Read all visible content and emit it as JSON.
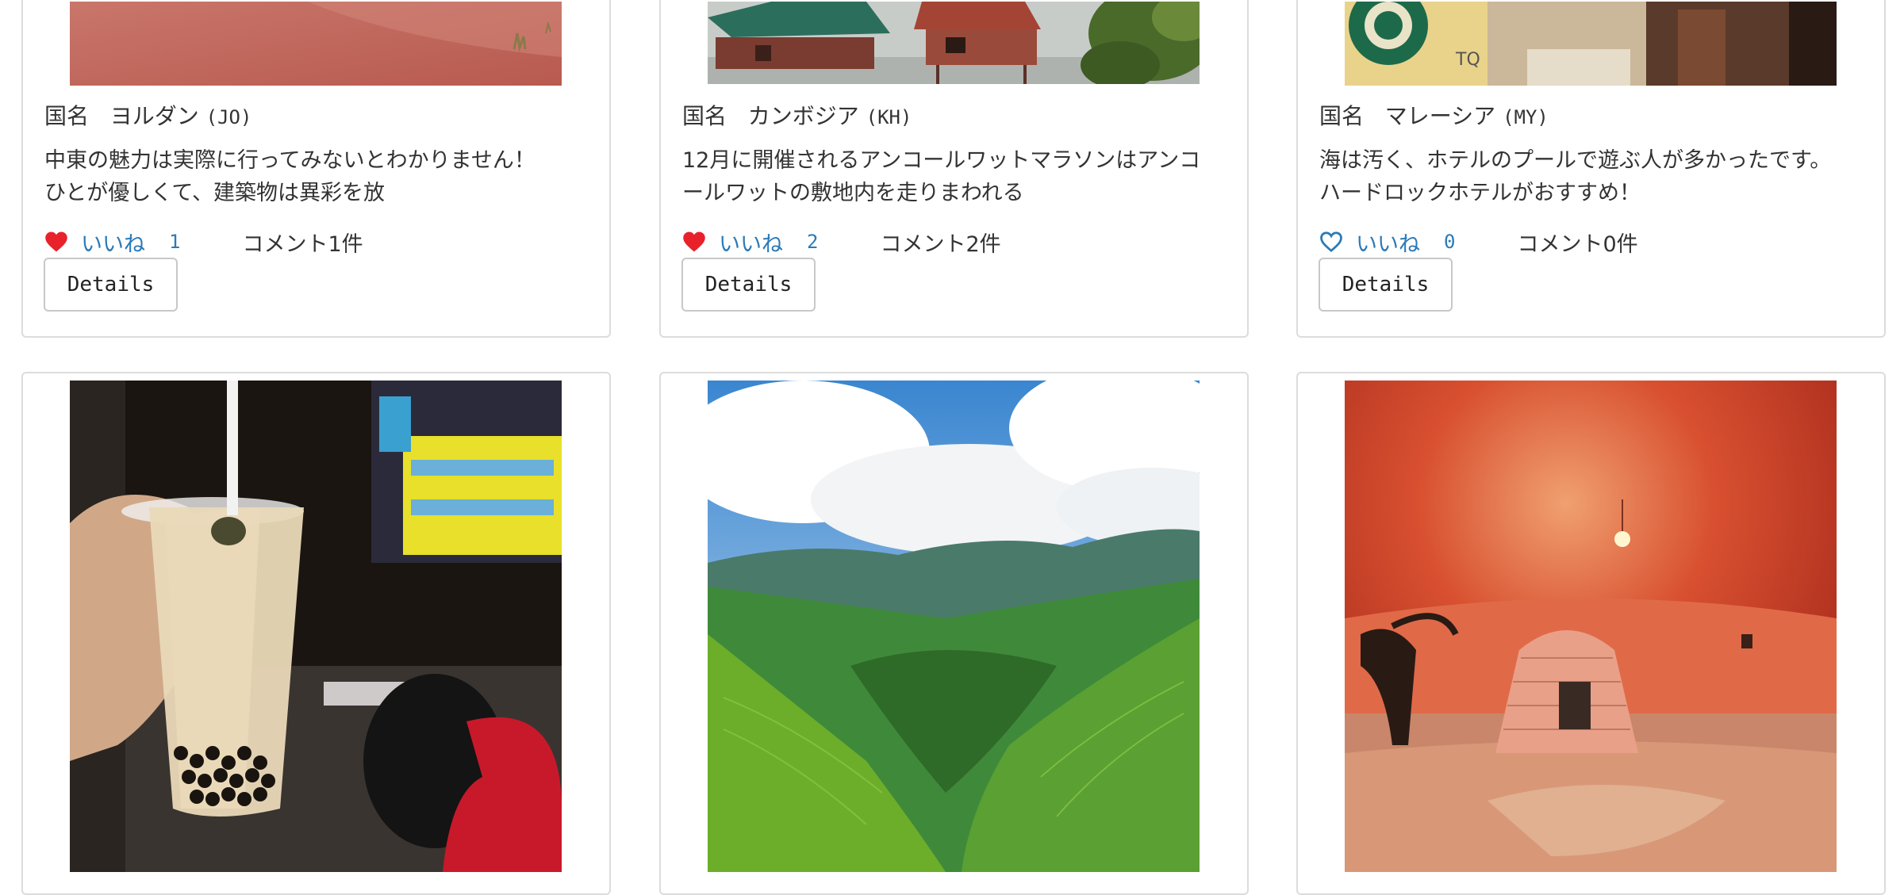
{
  "cards": [
    {
      "country_label": "国名",
      "country_name": "ヨルダン",
      "country_code": "(JO)",
      "desc_line1": "中東の魅力は実際に行ってみないとわかりません！",
      "desc_line2": "ひとが優しくて、建築物は異彩を放",
      "like_label": "いいね",
      "like_count": "1",
      "liked": true,
      "comments": "コメント1件",
      "details_label": "Details"
    },
    {
      "country_label": "国名",
      "country_name": "カンボジア",
      "country_code": "(KH)",
      "desc_line1": "12月に開催されるアンコールワットマラソンはアンコ",
      "desc_line2": "ールワットの敷地内を走りまわれる",
      "like_label": "いいね",
      "like_count": "2",
      "liked": true,
      "comments": "コメント2件",
      "details_label": "Details"
    },
    {
      "country_label": "国名",
      "country_name": "マレーシア",
      "country_code": "(MY)",
      "desc_line1": "海は汚く、ホテルのプールで遊ぶ人が多かったです。",
      "desc_line2": "ハードロックホテルがおすすめ！",
      "like_label": "いいね",
      "like_count": "0",
      "liked": false,
      "comments": "コメント0件",
      "details_label": "Details"
    }
  ],
  "colors": {
    "like_blue": "#2a7ab8",
    "heart_red": "#e8212b",
    "card_border": "#dcdcdc"
  }
}
